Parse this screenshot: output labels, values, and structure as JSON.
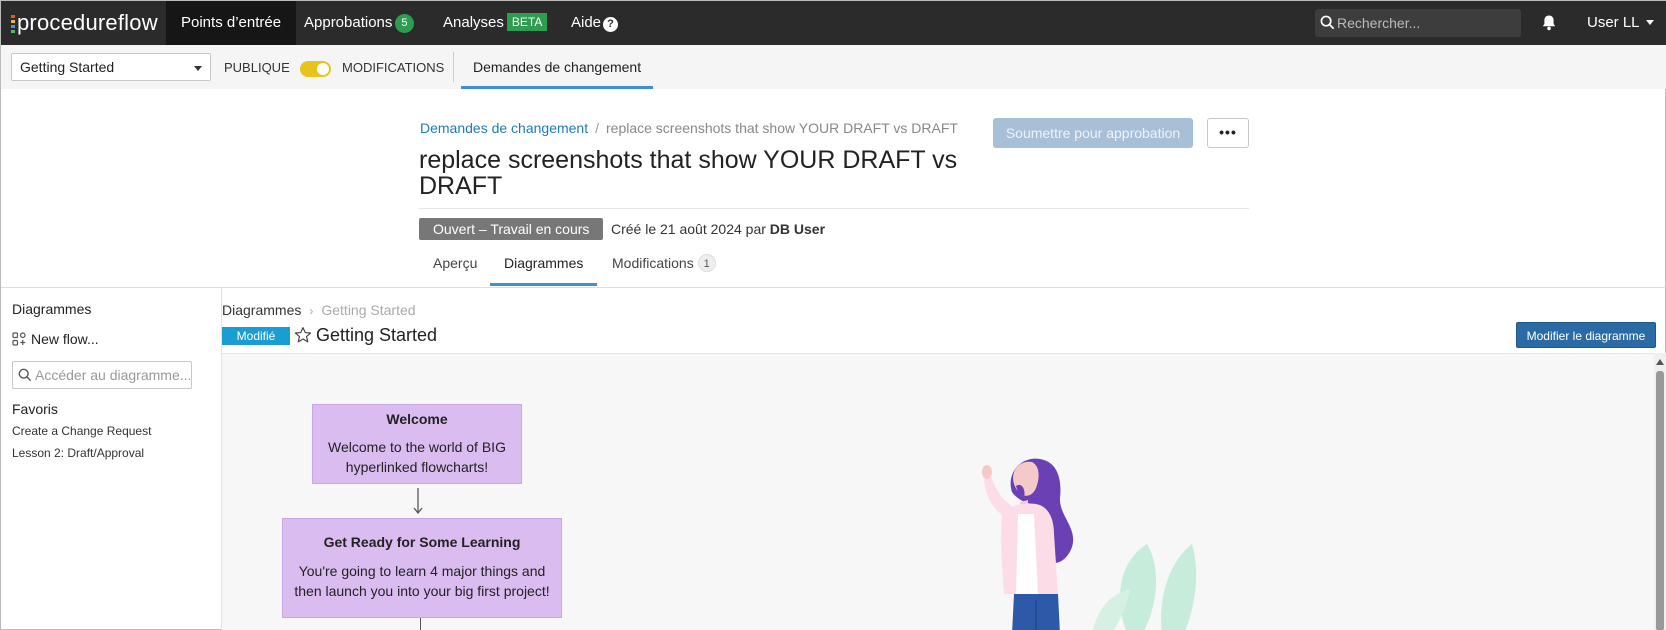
{
  "brand": {
    "name": "procedureflow",
    "bar_colors": [
      "#e9542f",
      "#f2b632",
      "#3f9be0",
      "#58b85d"
    ]
  },
  "nav": {
    "items": [
      {
        "label": "Points d’entrée"
      },
      {
        "label": "Approbations",
        "badge": "5"
      },
      {
        "label": "Analyses",
        "badge": "BETA"
      },
      {
        "label": "Aide",
        "icon": "help-icon"
      }
    ],
    "search_placeholder": "Rechercher...",
    "user": "User LL"
  },
  "subbar": {
    "selected_space": "Getting Started",
    "public_label": "PUBLIQUE",
    "modifications_label": "MODIFICATIONS",
    "toggle_on": true,
    "tab": "Demandes de changement"
  },
  "header": {
    "breadcrumb_link": "Demandes de changement",
    "breadcrumb_current": "replace screenshots that show YOUR DRAFT vs DRAFT",
    "title": "replace screenshots that show YOUR DRAFT vs DRAFT",
    "submit_label": "Soumettre pour approbation",
    "more_label": "•••",
    "status": "Ouvert – Travail en cours",
    "created_prefix": "Créé le 21 août 2024 par",
    "created_by": "DB User",
    "tabs": [
      {
        "label": "Aperçu"
      },
      {
        "label": "Diagrammes"
      },
      {
        "label": "Modifications",
        "count": "1"
      }
    ],
    "active_tab": "Diagrammes"
  },
  "sidebar": {
    "title": "Diagrammes",
    "new_flow": "New flow...",
    "search_placeholder": "Accéder au diagramme...",
    "favorites_title": "Favoris",
    "favorites": [
      "Create a Change Request",
      "Lesson 2: Draft/Approval"
    ]
  },
  "diagram": {
    "crumb_root": "Diagrammes",
    "crumb_current": "Getting Started",
    "modified_badge": "Modifié",
    "title": "Getting Started",
    "edit_label": "Modifier le diagramme",
    "nodes": [
      {
        "title": "Welcome",
        "body": "Welcome to the world of BIG hyperlinked flowcharts!"
      },
      {
        "title": "Get Ready for Some Learning",
        "body": "You're going to learn 4 major things and then launch you into your big first project!"
      }
    ],
    "colors": {
      "node_fill": "#dbbcf1",
      "accent": "#3d8fd6",
      "link": "#1f7bb6"
    }
  }
}
